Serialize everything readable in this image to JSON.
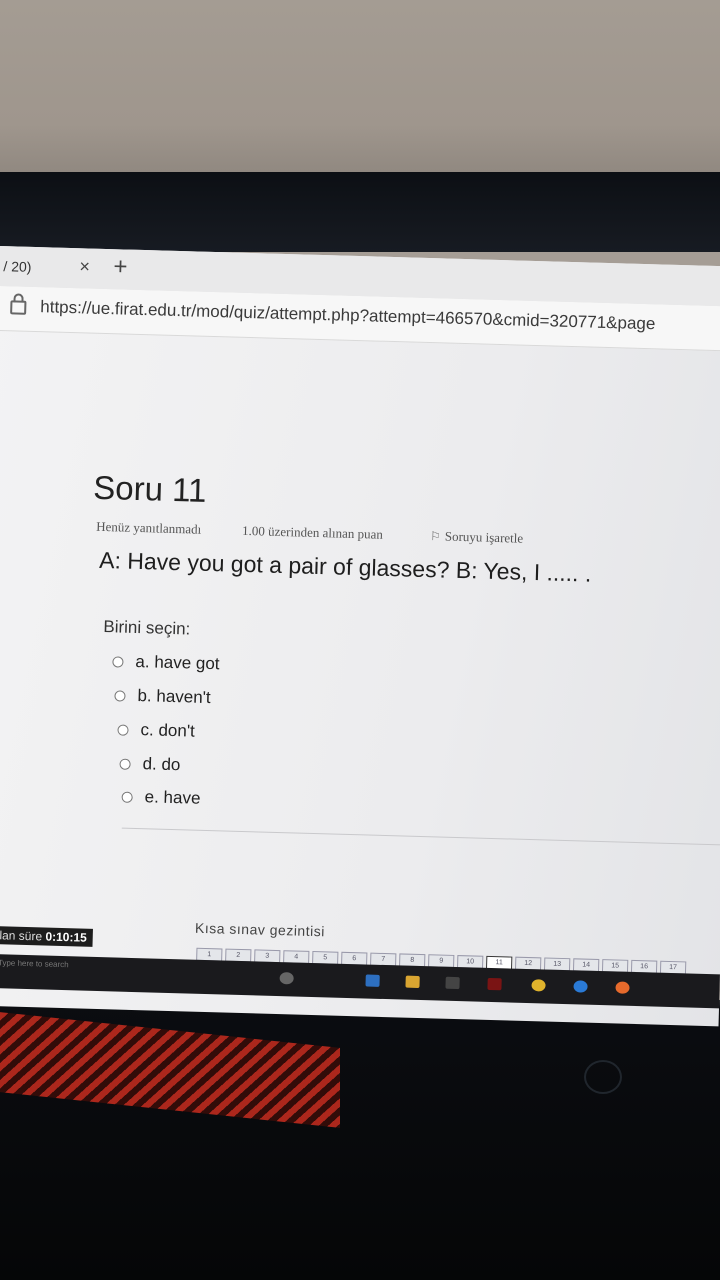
{
  "browser": {
    "tab_title": "/ 20)",
    "tab_close": "×",
    "new_tab": "+",
    "url": "https://ue.firat.edu.tr/mod/quiz/attempt.php?attempt=466570&cmid=320771&page"
  },
  "question": {
    "number": "Soru 11",
    "status": "Henüz yanıtlanmadı",
    "points": "1.00 üzerinden alınan puan",
    "flag_label": "Soruyu işaretle",
    "text": "A: Have you got a pair of glasses? B: Yes, I ..... .",
    "prompt": "Birini seçin:",
    "options": [
      {
        "label": "a. have got"
      },
      {
        "label": "b. haven't"
      },
      {
        "label": "c. don't"
      },
      {
        "label": "d. do"
      },
      {
        "label": "e. have"
      }
    ]
  },
  "navigation": {
    "title": "Kısa sınav gezintisi",
    "pages": [
      "1",
      "2",
      "3",
      "4",
      "5",
      "6",
      "7",
      "8",
      "9",
      "10",
      "11",
      "12",
      "13",
      "14",
      "15",
      "16",
      "17"
    ],
    "current_page": "11"
  },
  "timer": {
    "label": "Kalan süre",
    "value": "0:10:15"
  },
  "taskbar": {
    "search_placeholder": "Type here to search"
  }
}
